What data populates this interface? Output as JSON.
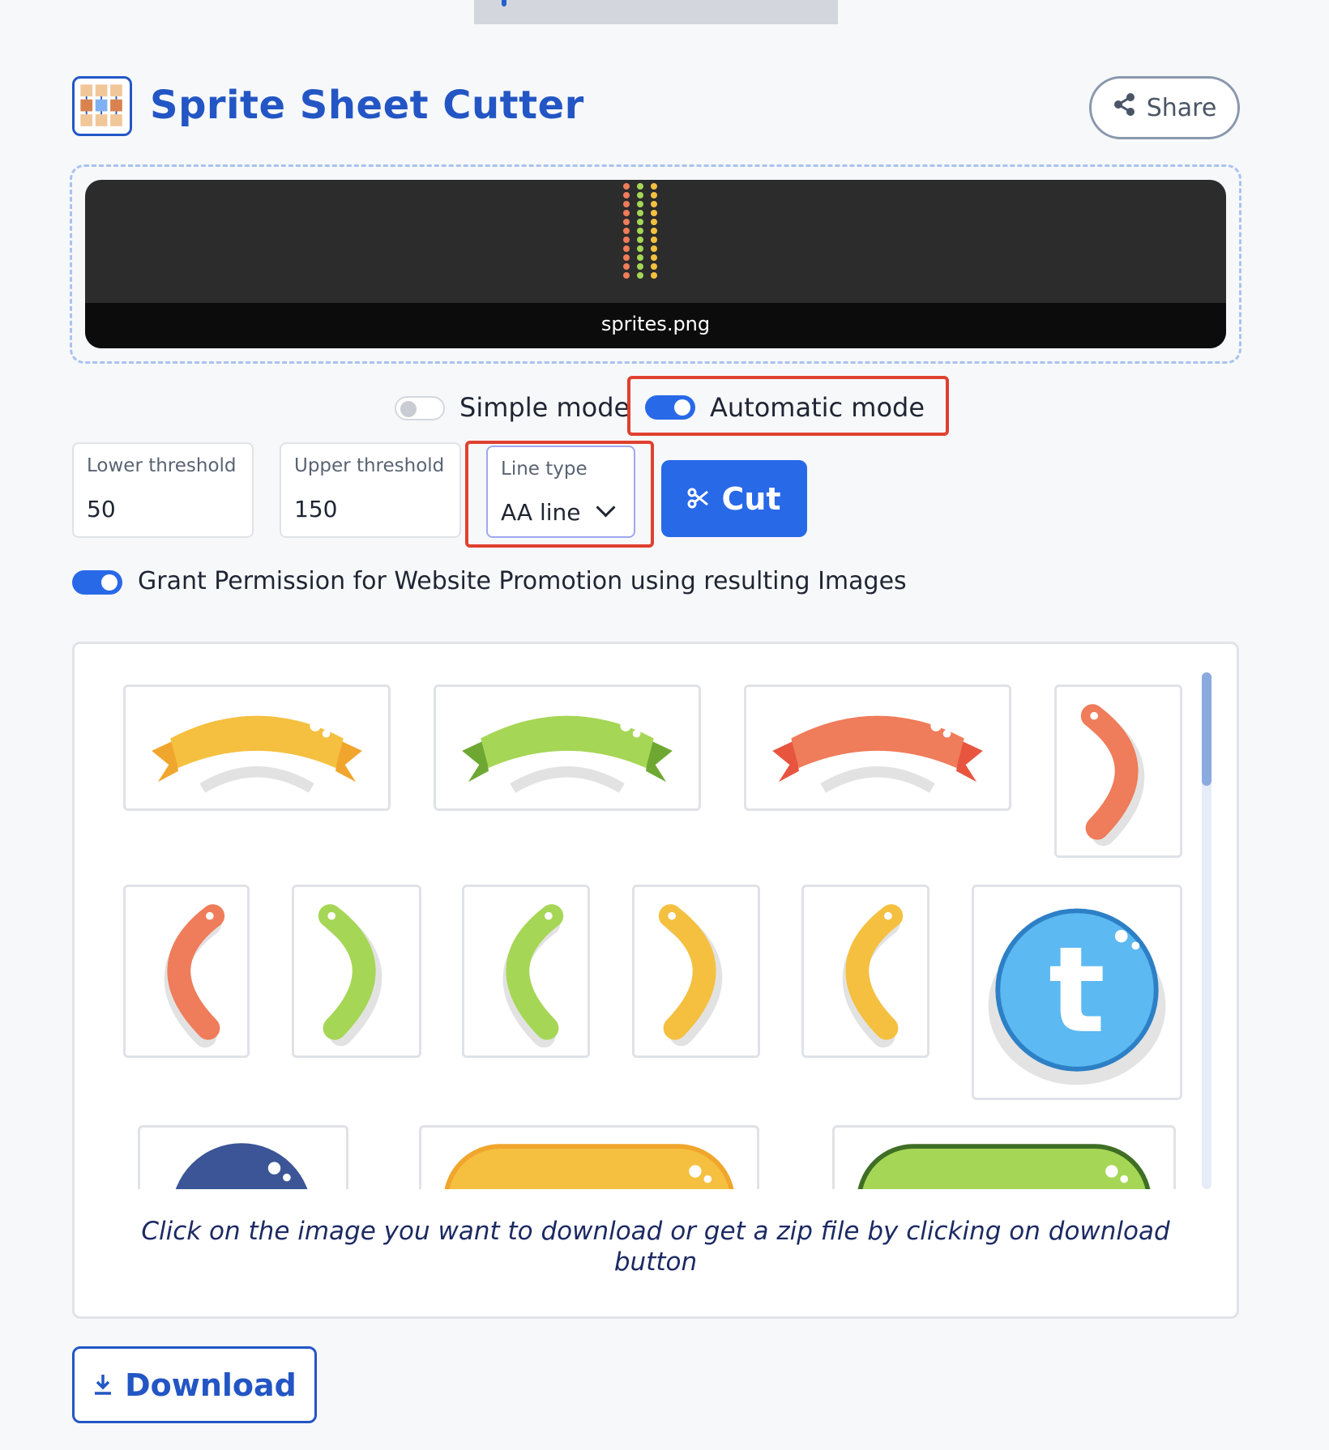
{
  "app": {
    "title": "Sprite Sheet Cutter",
    "share_label": "Share"
  },
  "upload": {
    "file_name": "sprites.png"
  },
  "modes": {
    "simple_label": "Simple mode",
    "simple_on": false,
    "automatic_label": "Automatic mode",
    "automatic_on": true
  },
  "controls": {
    "lower_threshold": {
      "label": "Lower threshold",
      "value": "50"
    },
    "upper_threshold": {
      "label": "Upper threshold",
      "value": "150"
    },
    "line_type": {
      "label": "Line type",
      "value": "AA line"
    },
    "cut_label": "Cut"
  },
  "permission": {
    "label": "Grant Permission for Website Promotion using resulting Images",
    "on": true
  },
  "results": {
    "instruction": "Click on the image you want to download or get a zip file by clicking on download button",
    "tiles": [
      "ribbon-yellow",
      "ribbon-green",
      "ribbon-red",
      "arrow-right-red",
      "arrow-left-red",
      "arrow-right-green",
      "arrow-left-green",
      "arrow-right-yellow",
      "arrow-left-yellow",
      "twitter-button-blue",
      "circle-navy",
      "pill-yellow",
      "pill-green"
    ]
  },
  "download_label": "Download",
  "colors": {
    "accent": "#2869e8",
    "title": "#2356c4",
    "highlight": "#e0402f",
    "yellow": "#f5c040",
    "green": "#a6d655",
    "red": "#ef7c5a",
    "blue": "#5cb9f2"
  }
}
